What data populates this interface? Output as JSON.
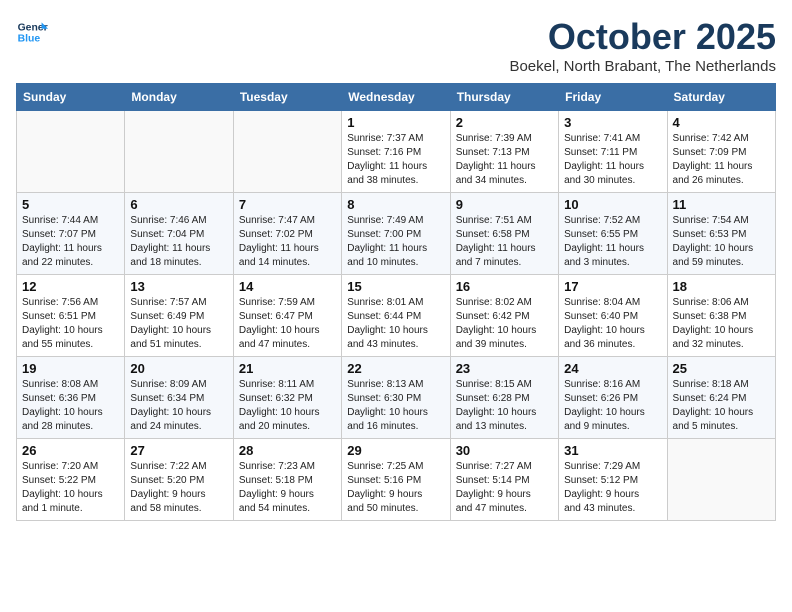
{
  "logo": {
    "line1": "General",
    "line2": "Blue"
  },
  "title": "October 2025",
  "subtitle": "Boekel, North Brabant, The Netherlands",
  "weekdays": [
    "Sunday",
    "Monday",
    "Tuesday",
    "Wednesday",
    "Thursday",
    "Friday",
    "Saturday"
  ],
  "weeks": [
    [
      {
        "day": "",
        "info": ""
      },
      {
        "day": "",
        "info": ""
      },
      {
        "day": "",
        "info": ""
      },
      {
        "day": "1",
        "info": "Sunrise: 7:37 AM\nSunset: 7:16 PM\nDaylight: 11 hours\nand 38 minutes."
      },
      {
        "day": "2",
        "info": "Sunrise: 7:39 AM\nSunset: 7:13 PM\nDaylight: 11 hours\nand 34 minutes."
      },
      {
        "day": "3",
        "info": "Sunrise: 7:41 AM\nSunset: 7:11 PM\nDaylight: 11 hours\nand 30 minutes."
      },
      {
        "day": "4",
        "info": "Sunrise: 7:42 AM\nSunset: 7:09 PM\nDaylight: 11 hours\nand 26 minutes."
      }
    ],
    [
      {
        "day": "5",
        "info": "Sunrise: 7:44 AM\nSunset: 7:07 PM\nDaylight: 11 hours\nand 22 minutes."
      },
      {
        "day": "6",
        "info": "Sunrise: 7:46 AM\nSunset: 7:04 PM\nDaylight: 11 hours\nand 18 minutes."
      },
      {
        "day": "7",
        "info": "Sunrise: 7:47 AM\nSunset: 7:02 PM\nDaylight: 11 hours\nand 14 minutes."
      },
      {
        "day": "8",
        "info": "Sunrise: 7:49 AM\nSunset: 7:00 PM\nDaylight: 11 hours\nand 10 minutes."
      },
      {
        "day": "9",
        "info": "Sunrise: 7:51 AM\nSunset: 6:58 PM\nDaylight: 11 hours\nand 7 minutes."
      },
      {
        "day": "10",
        "info": "Sunrise: 7:52 AM\nSunset: 6:55 PM\nDaylight: 11 hours\nand 3 minutes."
      },
      {
        "day": "11",
        "info": "Sunrise: 7:54 AM\nSunset: 6:53 PM\nDaylight: 10 hours\nand 59 minutes."
      }
    ],
    [
      {
        "day": "12",
        "info": "Sunrise: 7:56 AM\nSunset: 6:51 PM\nDaylight: 10 hours\nand 55 minutes."
      },
      {
        "day": "13",
        "info": "Sunrise: 7:57 AM\nSunset: 6:49 PM\nDaylight: 10 hours\nand 51 minutes."
      },
      {
        "day": "14",
        "info": "Sunrise: 7:59 AM\nSunset: 6:47 PM\nDaylight: 10 hours\nand 47 minutes."
      },
      {
        "day": "15",
        "info": "Sunrise: 8:01 AM\nSunset: 6:44 PM\nDaylight: 10 hours\nand 43 minutes."
      },
      {
        "day": "16",
        "info": "Sunrise: 8:02 AM\nSunset: 6:42 PM\nDaylight: 10 hours\nand 39 minutes."
      },
      {
        "day": "17",
        "info": "Sunrise: 8:04 AM\nSunset: 6:40 PM\nDaylight: 10 hours\nand 36 minutes."
      },
      {
        "day": "18",
        "info": "Sunrise: 8:06 AM\nSunset: 6:38 PM\nDaylight: 10 hours\nand 32 minutes."
      }
    ],
    [
      {
        "day": "19",
        "info": "Sunrise: 8:08 AM\nSunset: 6:36 PM\nDaylight: 10 hours\nand 28 minutes."
      },
      {
        "day": "20",
        "info": "Sunrise: 8:09 AM\nSunset: 6:34 PM\nDaylight: 10 hours\nand 24 minutes."
      },
      {
        "day": "21",
        "info": "Sunrise: 8:11 AM\nSunset: 6:32 PM\nDaylight: 10 hours\nand 20 minutes."
      },
      {
        "day": "22",
        "info": "Sunrise: 8:13 AM\nSunset: 6:30 PM\nDaylight: 10 hours\nand 16 minutes."
      },
      {
        "day": "23",
        "info": "Sunrise: 8:15 AM\nSunset: 6:28 PM\nDaylight: 10 hours\nand 13 minutes."
      },
      {
        "day": "24",
        "info": "Sunrise: 8:16 AM\nSunset: 6:26 PM\nDaylight: 10 hours\nand 9 minutes."
      },
      {
        "day": "25",
        "info": "Sunrise: 8:18 AM\nSunset: 6:24 PM\nDaylight: 10 hours\nand 5 minutes."
      }
    ],
    [
      {
        "day": "26",
        "info": "Sunrise: 7:20 AM\nSunset: 5:22 PM\nDaylight: 10 hours\nand 1 minute."
      },
      {
        "day": "27",
        "info": "Sunrise: 7:22 AM\nSunset: 5:20 PM\nDaylight: 9 hours\nand 58 minutes."
      },
      {
        "day": "28",
        "info": "Sunrise: 7:23 AM\nSunset: 5:18 PM\nDaylight: 9 hours\nand 54 minutes."
      },
      {
        "day": "29",
        "info": "Sunrise: 7:25 AM\nSunset: 5:16 PM\nDaylight: 9 hours\nand 50 minutes."
      },
      {
        "day": "30",
        "info": "Sunrise: 7:27 AM\nSunset: 5:14 PM\nDaylight: 9 hours\nand 47 minutes."
      },
      {
        "day": "31",
        "info": "Sunrise: 7:29 AM\nSunset: 5:12 PM\nDaylight: 9 hours\nand 43 minutes."
      },
      {
        "day": "",
        "info": ""
      }
    ]
  ]
}
